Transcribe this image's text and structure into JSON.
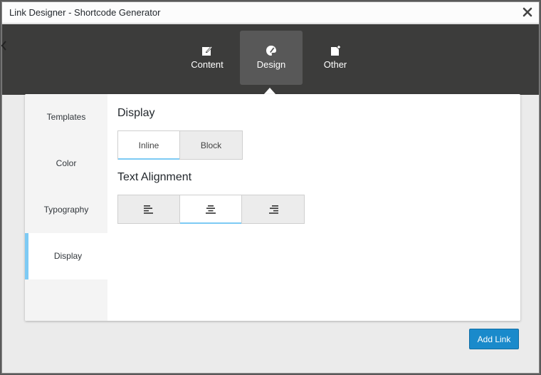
{
  "dialog": {
    "title": "Link Designer - Shortcode Generator",
    "close_icon": "close-icon"
  },
  "topnav": {
    "items": [
      {
        "label": "Content",
        "icon": "edit-icon",
        "active": false
      },
      {
        "label": "Design",
        "icon": "palette-icon",
        "active": true
      },
      {
        "label": "Other",
        "icon": "document-plus-icon",
        "active": false
      }
    ]
  },
  "sidebar": {
    "items": [
      {
        "label": "Templates",
        "active": false
      },
      {
        "label": "Color",
        "active": false
      },
      {
        "label": "Typography",
        "active": false
      },
      {
        "label": "Display",
        "active": true
      }
    ]
  },
  "main": {
    "display": {
      "title": "Display",
      "options": [
        {
          "label": "Inline",
          "selected": true
        },
        {
          "label": "Block",
          "selected": false
        }
      ]
    },
    "alignment": {
      "title": "Text Alignment",
      "options": [
        {
          "icon": "align-left-icon",
          "selected": false
        },
        {
          "icon": "align-center-icon",
          "selected": true
        },
        {
          "icon": "align-right-icon",
          "selected": false
        }
      ]
    }
  },
  "footer": {
    "add_link_label": "Add Link"
  },
  "colors": {
    "accent": "#7dcaf4",
    "primary_button": "#1a8acb",
    "nav_bg": "#3c3c3b",
    "nav_active": "#585858"
  }
}
